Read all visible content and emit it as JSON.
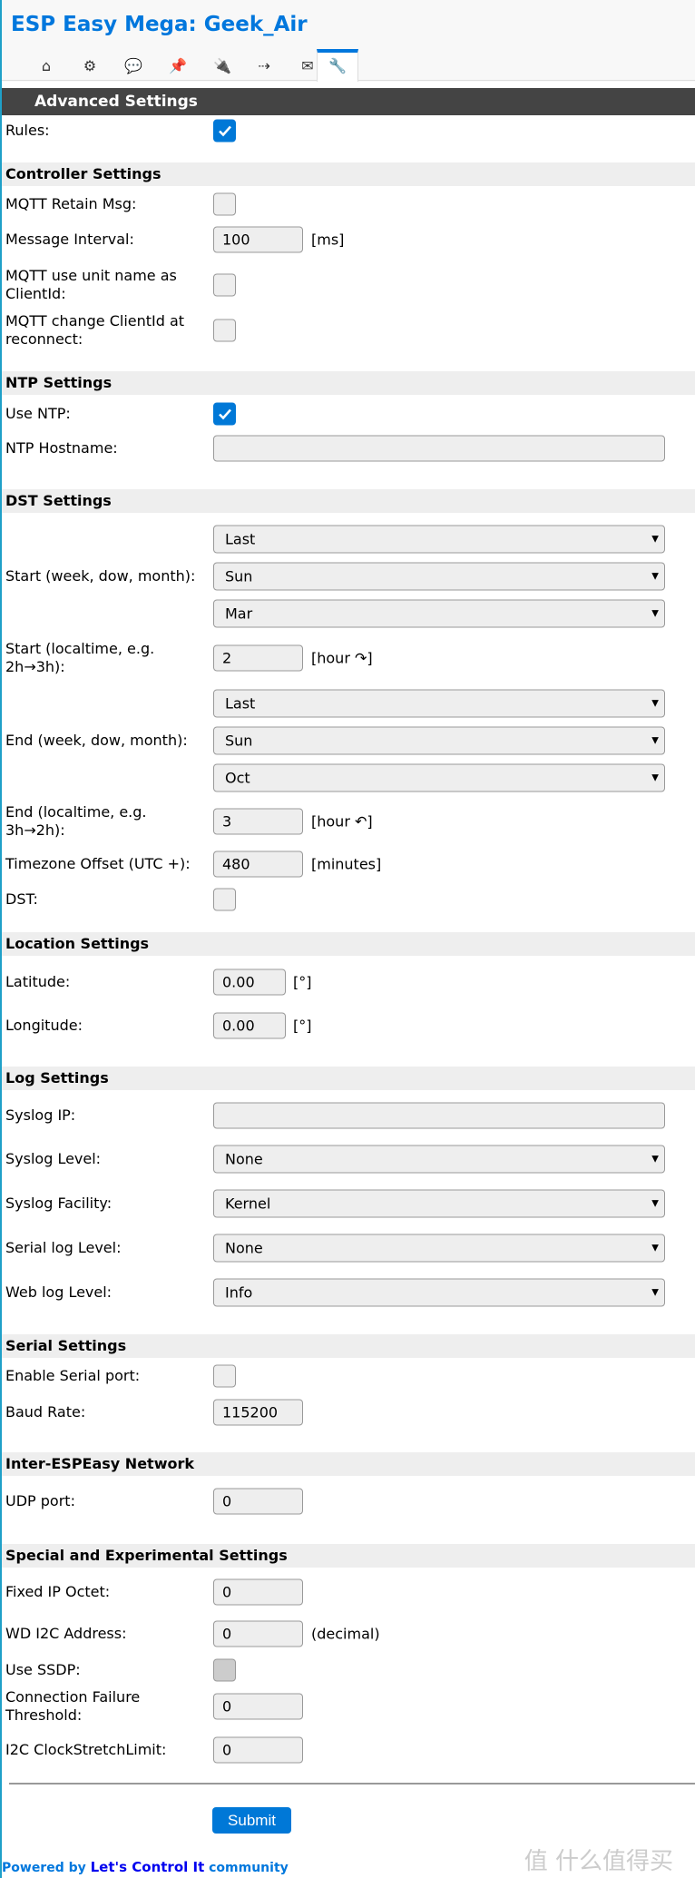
{
  "app": {
    "title": "ESP Easy Mega: Geek_Air"
  },
  "tabs": [
    {
      "icon": "home-icon",
      "glyph": "⌂"
    },
    {
      "icon": "gear-icon",
      "glyph": "⚙"
    },
    {
      "icon": "chat-icon",
      "glyph": "💬"
    },
    {
      "icon": "pin-icon",
      "glyph": "📌"
    },
    {
      "icon": "plug-icon",
      "glyph": "🔌"
    },
    {
      "icon": "arrow-right-icon",
      "glyph": "⇢"
    },
    {
      "icon": "mail-icon",
      "glyph": "✉"
    },
    {
      "icon": "wrench-icon",
      "glyph": "🔧",
      "active": true
    }
  ],
  "header": "Advanced Settings",
  "rules": {
    "label": "Rules:",
    "checked": true
  },
  "sections": [
    {
      "title": "Controller Settings",
      "rows": [
        {
          "label": "MQTT Retain Msg:",
          "type": "checkbox",
          "checked": false
        },
        {
          "label": "Message Interval:",
          "type": "input",
          "value": "100",
          "unit": "[ms]"
        },
        {
          "label": "MQTT use unit name as ClientId:",
          "type": "checkbox",
          "checked": false
        },
        {
          "label": "MQTT change ClientId at reconnect:",
          "type": "checkbox",
          "checked": false
        }
      ]
    },
    {
      "title": "NTP Settings",
      "rows": [
        {
          "label": "Use NTP:",
          "type": "checkbox",
          "checked": true
        },
        {
          "label": "NTP Hostname:",
          "type": "wide",
          "value": ""
        }
      ]
    },
    {
      "title": "DST Settings",
      "rows": [
        {
          "label": "",
          "type": "select",
          "value": "Last"
        },
        {
          "label": "Start (week, dow, month):",
          "type": "select",
          "value": "Sun"
        },
        {
          "label": "",
          "type": "select",
          "value": "Mar"
        },
        {
          "label": "Start (localtime, e.g. 2h→3h):",
          "type": "input",
          "value": "2",
          "unit": "[hour ↷]"
        },
        {
          "label": "",
          "type": "select",
          "value": "Last"
        },
        {
          "label": "End (week, dow, month):",
          "type": "select",
          "value": "Sun"
        },
        {
          "label": "",
          "type": "select",
          "value": "Oct"
        },
        {
          "label": "End (localtime, e.g. 3h→2h):",
          "type": "input",
          "value": "3",
          "unit": "[hour ↶]"
        },
        {
          "label": "Timezone Offset (UTC +):",
          "type": "input",
          "value": "480",
          "unit": "[minutes]"
        },
        {
          "label": "DST:",
          "type": "checkbox",
          "checked": false
        }
      ]
    },
    {
      "title": "Location Settings",
      "rows": [
        {
          "label": "Latitude:",
          "type": "small",
          "value": "0.00",
          "unit": "[°]"
        },
        {
          "label": "Longitude:",
          "type": "small",
          "value": "0.00",
          "unit": "[°]"
        }
      ]
    },
    {
      "title": "Log Settings",
      "rows": [
        {
          "label": "Syslog IP:",
          "type": "wide",
          "value": ""
        },
        {
          "label": "Syslog Level:",
          "type": "select",
          "value": "None"
        },
        {
          "label": "Syslog Facility:",
          "type": "select",
          "value": "Kernel"
        },
        {
          "label": "Serial log Level:",
          "type": "select",
          "value": "None"
        },
        {
          "label": "Web log Level:",
          "type": "select",
          "value": "Info"
        }
      ]
    },
    {
      "title": "Serial Settings",
      "rows": [
        {
          "label": "Enable Serial port:",
          "type": "checkbox",
          "checked": false
        },
        {
          "label": "Baud Rate:",
          "type": "input",
          "value": "115200"
        }
      ]
    },
    {
      "title": "Inter-ESPEasy Network",
      "rows": [
        {
          "label": "UDP port:",
          "type": "input",
          "value": "0"
        }
      ]
    },
    {
      "title": "Special and Experimental Settings",
      "rows": [
        {
          "label": "Fixed IP Octet:",
          "type": "input",
          "value": "0"
        },
        {
          "label": "WD I2C Address:",
          "type": "input",
          "value": "0",
          "unit": "(decimal)"
        },
        {
          "label": "Use SSDP:",
          "type": "checkbox",
          "checked": false,
          "disabled": true
        },
        {
          "label": "Connection Failure Threshold:",
          "type": "input",
          "value": "0"
        },
        {
          "label": "I2C ClockStretchLimit:",
          "type": "input",
          "value": "0"
        }
      ]
    }
  ],
  "submit_label": "Submit",
  "footer": {
    "prefix": "Powered by ",
    "link": "Let's Control It",
    "suffix": " community"
  },
  "watermark": "值 什么值得买",
  "colors": {
    "accent": "#0078d7",
    "title": "#0077dd",
    "header_bg": "#444444"
  }
}
